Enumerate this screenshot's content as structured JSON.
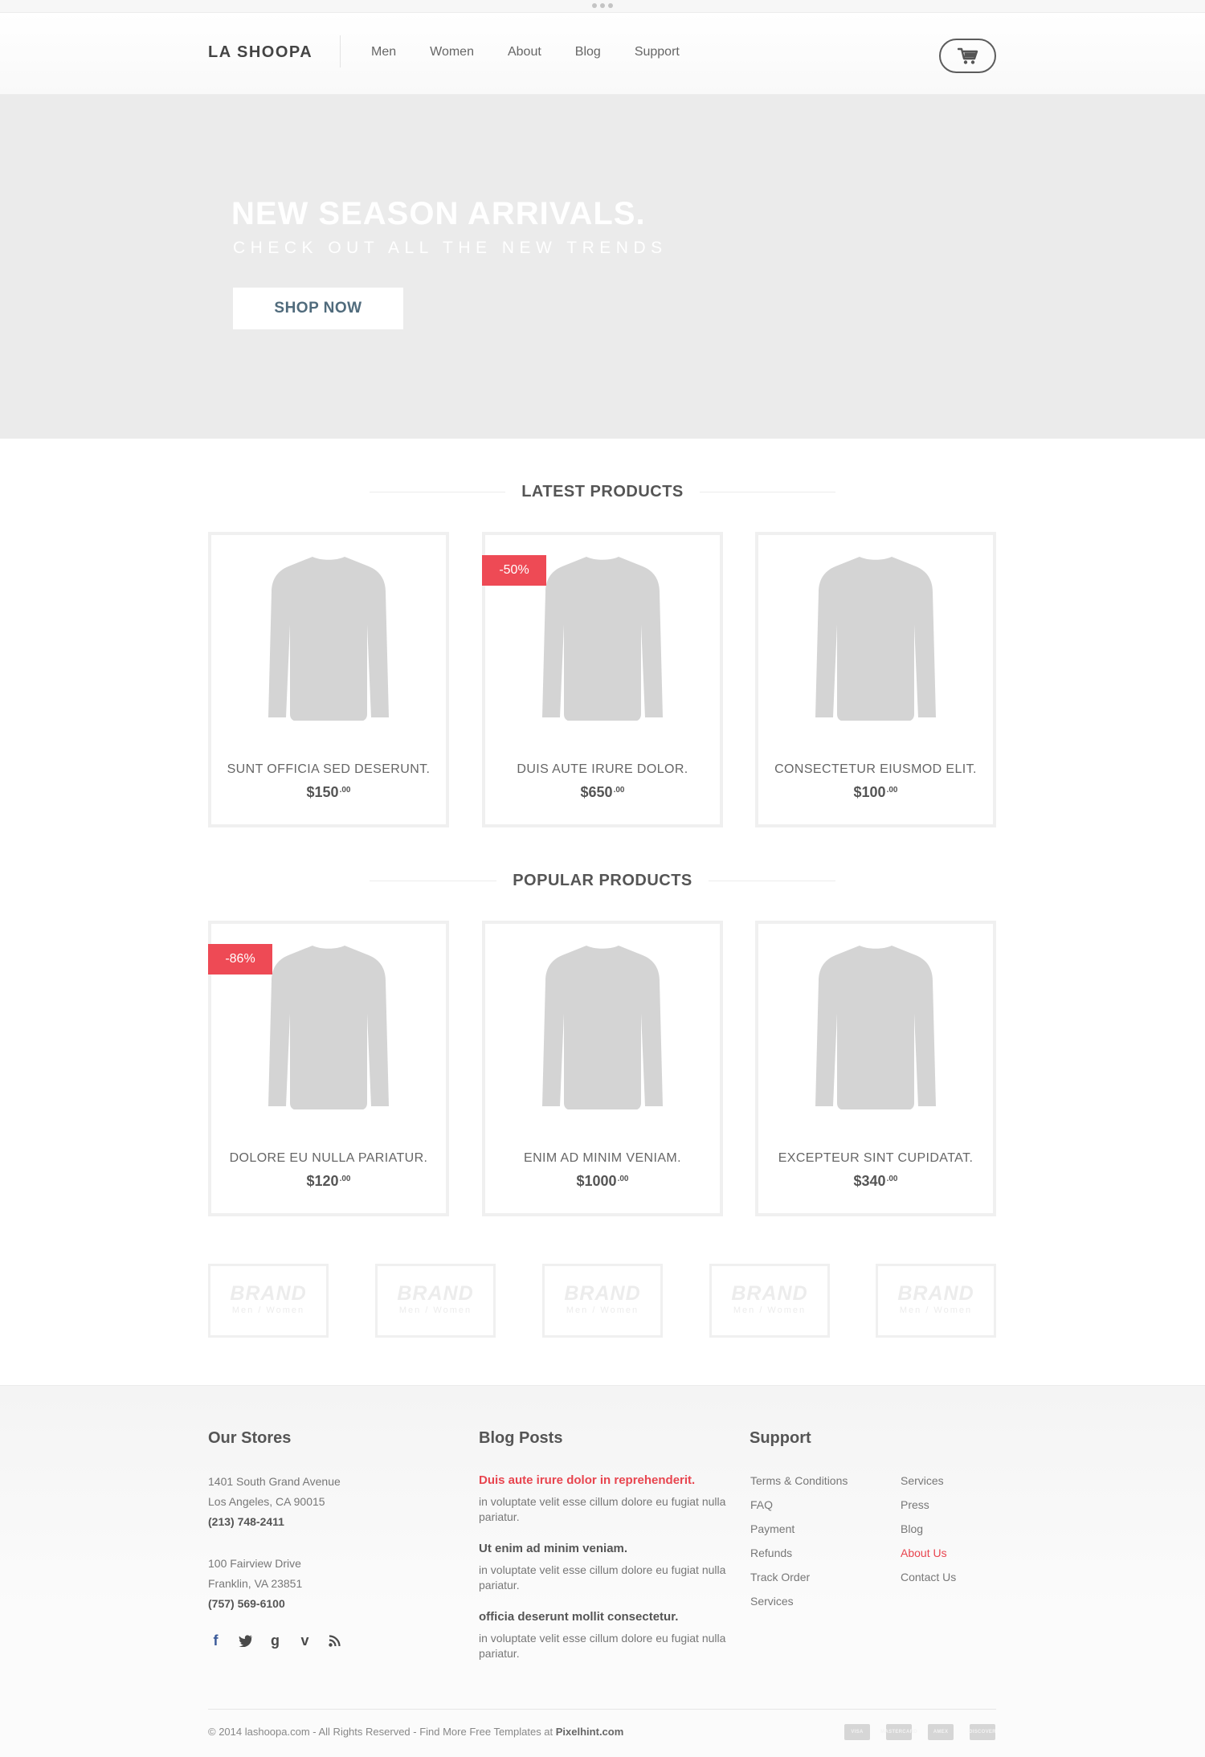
{
  "header": {
    "logo": "LA SHOOPA",
    "nav": [
      "Men",
      "Women",
      "About",
      "Blog",
      "Support"
    ]
  },
  "hero": {
    "title": "NEW SEASON ARRIVALS.",
    "subtitle": "CHECK OUT ALL THE NEW TRENDS",
    "button": "SHOP NOW"
  },
  "latest": {
    "title": "LATEST PRODUCTS",
    "products": [
      {
        "name": "SUNT OFFICIA SED DESERUNT.",
        "price": "$150",
        "cents": ".00",
        "badge": ""
      },
      {
        "name": "DUIS AUTE IRURE DOLOR.",
        "price": "$650",
        "cents": ".00",
        "badge": "-50%"
      },
      {
        "name": "CONSECTETUR EIUSMOD ELIT.",
        "price": "$100",
        "cents": ".00",
        "badge": ""
      }
    ]
  },
  "popular": {
    "title": "POPULAR PRODUCTS",
    "products": [
      {
        "name": "DOLORE EU NULLA PARIATUR.",
        "price": "$120",
        "cents": ".00",
        "badge": "-86%"
      },
      {
        "name": "ENIM AD MINIM VENIAM.",
        "price": "$1000",
        "cents": ".00",
        "badge": ""
      },
      {
        "name": "EXCEPTEUR SINT CUPIDATAT.",
        "price": "$340",
        "cents": ".00",
        "badge": ""
      }
    ]
  },
  "brands": [
    {
      "name": "BRAND",
      "sub": "Men / Women"
    },
    {
      "name": "BRAND",
      "sub": "Men / Women"
    },
    {
      "name": "BRAND",
      "sub": "Men / Women"
    },
    {
      "name": "BRAND",
      "sub": "Men / Women"
    },
    {
      "name": "BRAND",
      "sub": "Men / Women"
    }
  ],
  "footer": {
    "stores": {
      "title": "Our Stores",
      "store1": {
        "line1": "1401 South Grand Avenue",
        "line2": "Los Angeles, CA 90015",
        "phone": "(213) 748-2411"
      },
      "store2": {
        "line1": "100 Fairview Drive",
        "line2": "Franklin, VA 23851",
        "phone": "(757) 569-6100"
      }
    },
    "blog": {
      "title": "Blog Posts",
      "posts": [
        {
          "title": "Duis aute irure dolor in reprehenderit.",
          "body": " in voluptate velit esse cillum dolore eu fugiat nulla pariatur."
        },
        {
          "title": "Ut enim ad minim veniam.",
          "body": " in voluptate velit esse cillum dolore eu fugiat nulla pariatur."
        },
        {
          "title": "officia deserunt mollit consectetur.",
          "body": " in voluptate velit esse cillum dolore eu fugiat nulla pariatur."
        }
      ]
    },
    "support": {
      "title": "Support",
      "col1": [
        "Terms & Conditions",
        "FAQ",
        "Payment",
        "Refunds",
        "Track Order",
        "Services"
      ],
      "col2": [
        "Services",
        "Press",
        "Blog",
        "About Us",
        "Contact Us"
      ]
    },
    "social": [
      "facebook-icon",
      "twitter-icon",
      "google-plus-icon",
      "vimeo-icon",
      "rss-icon"
    ],
    "copyright": "© 2014 lashoopa.com  -  All Rights Reserved  -  Find More Free Templates at ",
    "copyright_link": "Pixelhint.com",
    "payment_cards": [
      "VISA",
      "MASTERCARD",
      "AMEX",
      "DISCOVER"
    ]
  },
  "colors": {
    "accent_red": "#ee4a55",
    "hero_bg": "#ebebeb",
    "button_text": "#506b7c",
    "product_gray": "#d4d4d4",
    "facebook_blue": "#3b5b9a"
  }
}
